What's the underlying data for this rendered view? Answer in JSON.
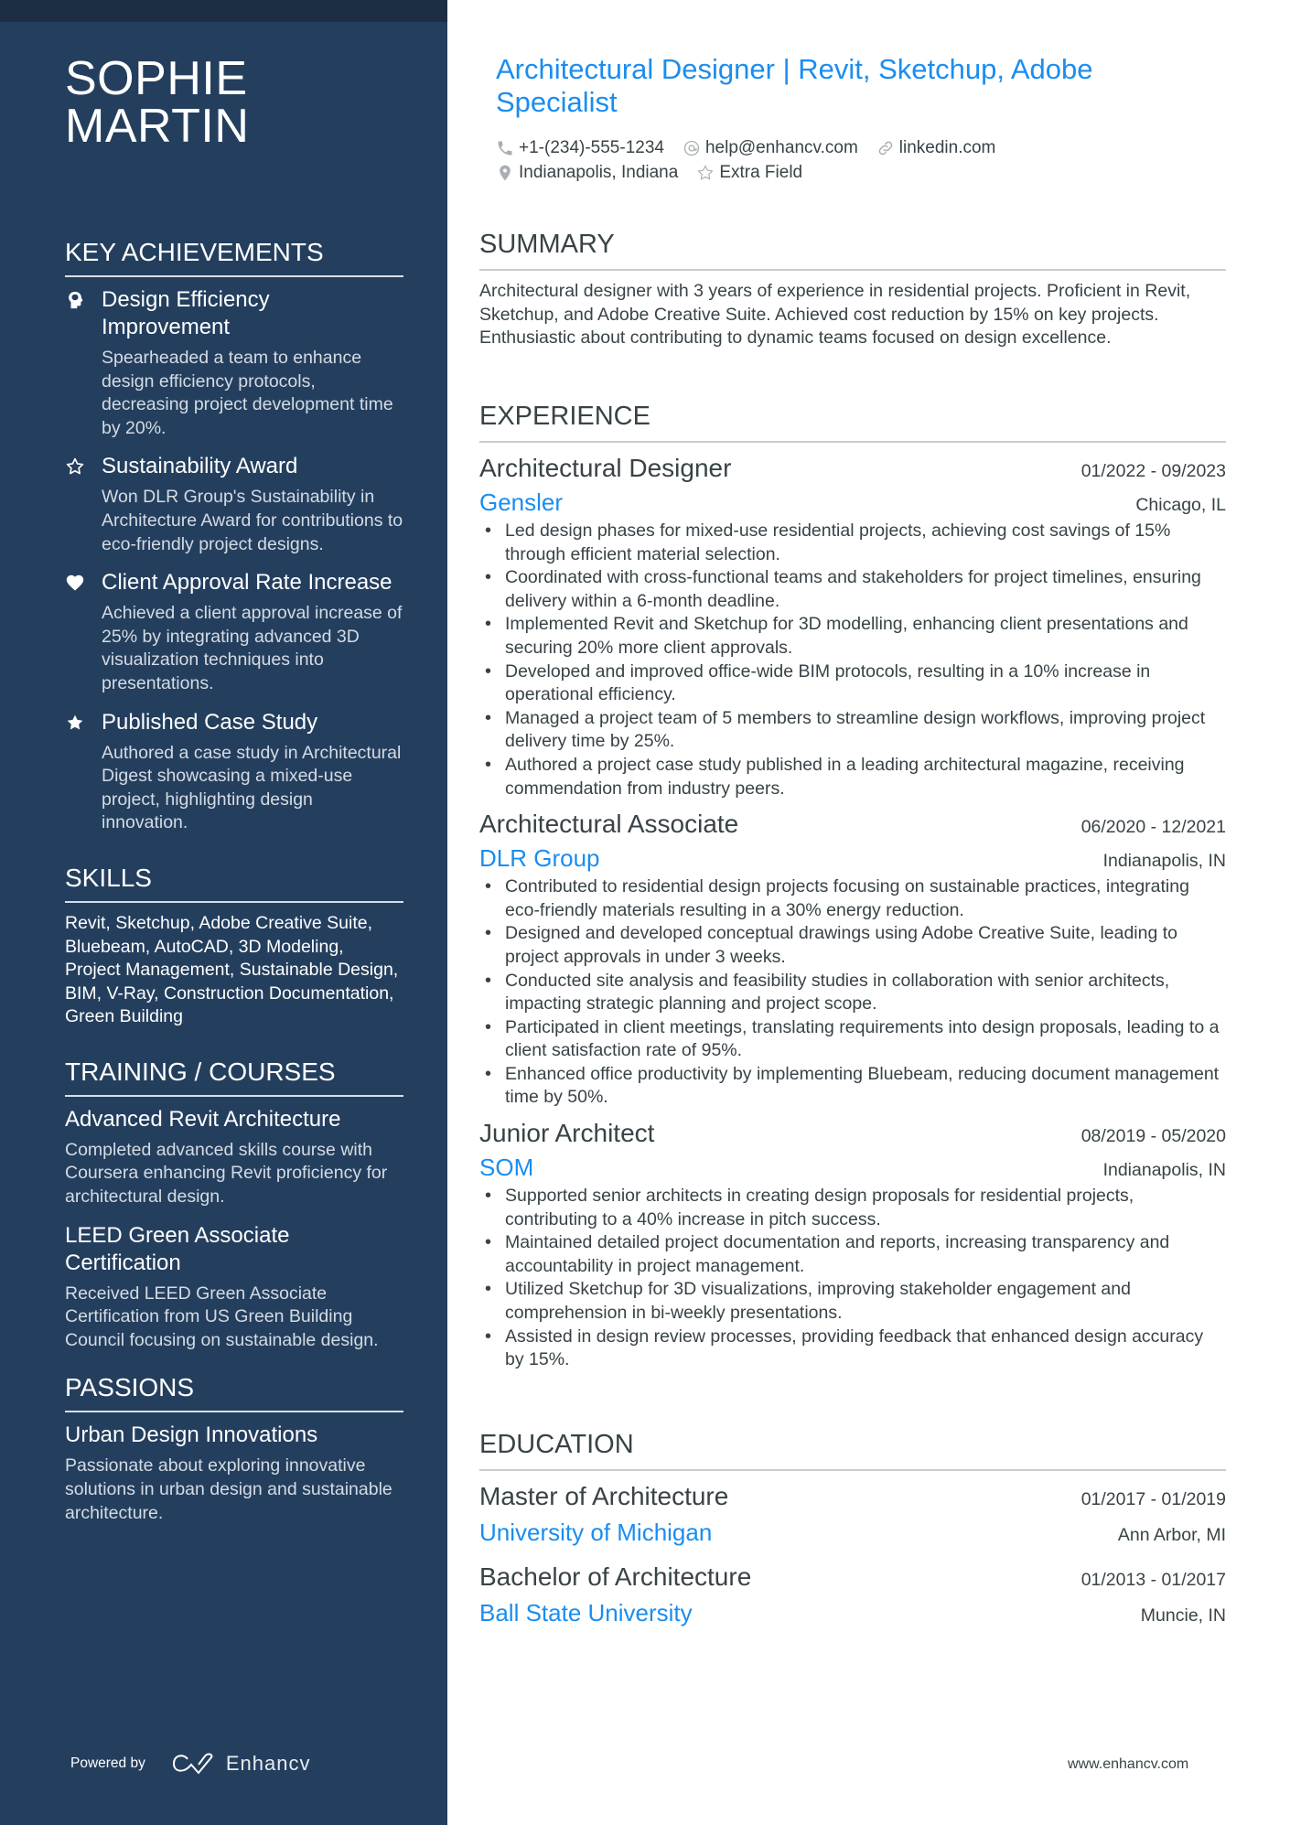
{
  "sidebar": {
    "name_line1": "SOPHIE",
    "name_line2": "MARTIN",
    "key_achievements": {
      "heading": "KEY ACHIEVEMENTS",
      "items": [
        {
          "icon": "brain-head-icon",
          "title": "Design Efficiency Improvement",
          "description": "Spearheaded a team to enhance design efficiency protocols, decreasing project development time by 20%."
        },
        {
          "icon": "star-outline-icon",
          "title": "Sustainability Award",
          "description": "Won DLR Group's Sustainability in Architecture Award for contributions to eco-friendly project designs."
        },
        {
          "icon": "heart-icon",
          "title": "Client Approval Rate Increase",
          "description": "Achieved a client approval increase of 25% by integrating advanced 3D visualization techniques into presentations."
        },
        {
          "icon": "star-filled-icon",
          "title": "Published Case Study",
          "description": "Authored a case study in Architectural Digest showcasing a mixed-use project, highlighting design innovation."
        }
      ]
    },
    "skills": {
      "heading": "SKILLS",
      "text": "Revit, Sketchup, Adobe Creative Suite, Bluebeam, AutoCAD, 3D Modeling, Project Management, Sustainable Design, BIM, V-Ray, Construction Documentation, Green Building"
    },
    "training": {
      "heading": "TRAINING / COURSES",
      "items": [
        {
          "title": "Advanced Revit Architecture",
          "description": "Completed advanced skills course with Coursera enhancing Revit proficiency for architectural design."
        },
        {
          "title": "LEED Green Associate Certification",
          "description": "Received LEED Green Associate Certification from US Green Building Council focusing on sustainable design."
        }
      ]
    },
    "passions": {
      "heading": "PASSIONS",
      "items": [
        {
          "title": "Urban Design Innovations",
          "description": "Passionate about exploring innovative solutions in urban design and sustainable architecture."
        }
      ]
    },
    "powered_by": "Powered by",
    "brand": "Enhancv"
  },
  "main": {
    "headline": "Architectural Designer | Revit, Sketchup, Adobe Specialist",
    "contacts": {
      "phone": "+1-(234)-555-1234",
      "email": "help@enhancv.com",
      "link": "linkedin.com",
      "location": "Indianapolis, Indiana",
      "extra": "Extra Field"
    },
    "summary": {
      "heading": "SUMMARY",
      "text": "Architectural designer with 3 years of experience in residential projects. Proficient in Revit, Sketchup, and Adobe Creative Suite. Achieved cost reduction by 15% on key projects. Enthusiastic about contributing to dynamic teams focused on design excellence."
    },
    "experience": {
      "heading": "EXPERIENCE",
      "jobs": [
        {
          "title": "Architectural Designer",
          "dates": "01/2022 - 09/2023",
          "company": "Gensler",
          "location": "Chicago, IL",
          "bullets": [
            "Led design phases for mixed-use residential projects, achieving cost savings of 15% through efficient material selection.",
            "Coordinated with cross-functional teams and stakeholders for project timelines, ensuring delivery within a 6-month deadline.",
            "Implemented Revit and Sketchup for 3D modelling, enhancing client presentations and securing 20% more client approvals.",
            "Developed and improved office-wide BIM protocols, resulting in a 10% increase in operational efficiency.",
            "Managed a project team of 5 members to streamline design workflows, improving project delivery time by 25%.",
            "Authored a project case study published in a leading architectural magazine, receiving commendation from industry peers."
          ]
        },
        {
          "title": "Architectural Associate",
          "dates": "06/2020 - 12/2021",
          "company": "DLR Group",
          "location": "Indianapolis, IN",
          "bullets": [
            "Contributed to residential design projects focusing on sustainable practices, integrating eco-friendly materials resulting in a 30% energy reduction.",
            "Designed and developed conceptual drawings using Adobe Creative Suite, leading to project approvals in under 3 weeks.",
            "Conducted site analysis and feasibility studies in collaboration with senior architects, impacting strategic planning and project scope.",
            "Participated in client meetings, translating requirements into design proposals, leading to a client satisfaction rate of 95%.",
            "Enhanced office productivity by implementing Bluebeam, reducing document management time by 50%."
          ]
        },
        {
          "title": "Junior Architect",
          "dates": "08/2019 - 05/2020",
          "company": "SOM",
          "location": "Indianapolis, IN",
          "bullets": [
            "Supported senior architects in creating design proposals for residential projects, contributing to a 40% increase in pitch success.",
            "Maintained detailed project documentation and reports, increasing transparency and accountability in project management.",
            "Utilized Sketchup for 3D visualizations, improving stakeholder engagement and comprehension in bi-weekly presentations.",
            "Assisted in design review processes, providing feedback that enhanced design accuracy by 15%."
          ]
        }
      ]
    },
    "education": {
      "heading": "EDUCATION",
      "items": [
        {
          "degree": "Master of Architecture",
          "dates": "01/2017 - 01/2019",
          "school": "University of Michigan",
          "location": "Ann Arbor, MI"
        },
        {
          "degree": "Bachelor of Architecture",
          "dates": "01/2013 - 01/2017",
          "school": "Ball State University",
          "location": "Muncie, IN"
        }
      ]
    },
    "footer_url": "www.enhancv.com"
  },
  "colors": {
    "sidebar_bg": "#243f5e",
    "top_strip": "#1c2e44",
    "accent": "#1a8df0",
    "body_text": "#384347"
  }
}
